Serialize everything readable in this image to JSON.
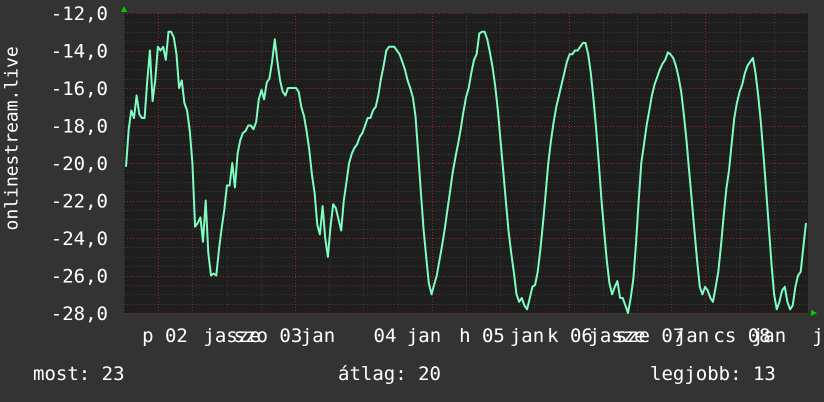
{
  "chart_data": {
    "type": "line",
    "ylabel": "onlinestream.live",
    "ylim": [
      -28,
      -12
    ],
    "yticks": [
      "-12,0",
      "-14,0",
      "-16,0",
      "-18,0",
      "-20,0",
      "-22,0",
      "-24,0",
      "-26,0",
      "-28,0"
    ],
    "xticks": [
      "p 02",
      "jasze",
      "szo 03",
      "jan",
      "04",
      "jan",
      "h 05",
      "jan",
      "k 06",
      "jasze",
      "sze 07",
      "jan",
      "cs 08",
      "jan",
      "j"
    ],
    "grid": true,
    "colors": {
      "line": "#7ffcc0",
      "background": "#333333",
      "plot": "#1e1e1e",
      "grid_minor": "#3c3c3c",
      "grid_major": "#8a2a2a"
    },
    "series": [
      {
        "values": [
          -20.2,
          -18.2,
          -17.2,
          -17.6,
          -16.4,
          -17.4,
          -17.6,
          -17.6,
          -15.6,
          -14.0,
          -16.7,
          -15.6,
          -13.8,
          -14.0,
          -13.8,
          -14.5,
          -13.0,
          -13.0,
          -13.3,
          -14.2,
          -16.0,
          -15.6,
          -16.8,
          -17.2,
          -18.3,
          -20.0,
          -23.4,
          -23.2,
          -22.9,
          -24.2,
          -22.0,
          -24.8,
          -26.0,
          -25.9,
          -26.0,
          -24.6,
          -23.5,
          -22.5,
          -21.2,
          -21.2,
          -20.0,
          -21.3,
          -19.5,
          -18.8,
          -18.4,
          -18.3,
          -18.0,
          -18.0,
          -18.2,
          -17.8,
          -16.6,
          -16.1,
          -16.6,
          -15.7,
          -15.5,
          -14.6,
          -13.4,
          -14.6,
          -15.6,
          -16.2,
          -16.4,
          -16.0,
          -16.0,
          -16.0,
          -16.0,
          -16.2,
          -17.0,
          -17.5,
          -18.3,
          -19.3,
          -20.6,
          -21.6,
          -23.3,
          -23.8,
          -22.3,
          -24.0,
          -25.0,
          -23.4,
          -22.2,
          -22.4,
          -23.0,
          -23.6,
          -22.0,
          -21.0,
          -20.0,
          -19.5,
          -19.2,
          -19.0,
          -18.6,
          -18.4,
          -18.0,
          -17.6,
          -17.6,
          -17.2,
          -17.0,
          -16.4,
          -15.5,
          -14.8,
          -14.0,
          -13.8,
          -13.8,
          -13.8,
          -14.0,
          -14.2,
          -14.6,
          -15.0,
          -15.6,
          -16.0,
          -16.5,
          -17.5,
          -19.5,
          -21.5,
          -23.5,
          -25.0,
          -26.4,
          -27.0,
          -26.5,
          -26.0,
          -25.2,
          -24.4,
          -23.5,
          -22.5,
          -21.5,
          -20.5,
          -19.7,
          -19.0,
          -18.2,
          -17.3,
          -16.5,
          -16.0,
          -15.2,
          -14.5,
          -14.2,
          -13.1,
          -13.0,
          -13.0,
          -13.4,
          -14.1,
          -14.9,
          -15.9,
          -17.2,
          -18.8,
          -20.4,
          -22.0,
          -23.6,
          -24.8,
          -25.8,
          -27.0,
          -27.4,
          -27.2,
          -27.6,
          -27.8,
          -27.2,
          -26.6,
          -26.5,
          -25.8,
          -24.6,
          -23.2,
          -21.6,
          -20.0,
          -18.8,
          -17.8,
          -17.0,
          -16.4,
          -15.8,
          -15.2,
          -14.6,
          -14.2,
          -14.2,
          -14.0,
          -14.0,
          -13.8,
          -13.6,
          -13.6,
          -14.2,
          -15.2,
          -16.6,
          -18.2,
          -20.0,
          -22.0,
          -23.6,
          -25.2,
          -26.4,
          -27.0,
          -26.6,
          -26.3,
          -27.2,
          -27.2,
          -27.6,
          -28.0,
          -27.2,
          -26.2,
          -24.3,
          -22.0,
          -20.0,
          -19.0,
          -18.0,
          -17.2,
          -16.4,
          -15.8,
          -15.4,
          -15.0,
          -14.7,
          -14.5,
          -14.1,
          -14.2,
          -14.4,
          -14.8,
          -15.4,
          -16.2,
          -17.4,
          -18.8,
          -20.4,
          -22.0,
          -23.6,
          -25.2,
          -26.6,
          -27.0,
          -26.6,
          -26.8,
          -27.2,
          -27.4,
          -26.6,
          -25.8,
          -24.4,
          -22.8,
          -21.4,
          -20.4,
          -19.0,
          -17.6,
          -16.8,
          -16.2,
          -15.8,
          -15.2,
          -14.8,
          -14.6,
          -14.4,
          -15.2,
          -16.4,
          -17.8,
          -19.6,
          -21.5,
          -23.4,
          -25.4,
          -27.0,
          -27.8,
          -27.4,
          -26.8,
          -26.6,
          -27.4,
          -27.8,
          -27.6,
          -26.6,
          -26.0,
          -25.8,
          -24.5,
          -23.2
        ]
      }
    ]
  },
  "footer": {
    "now": "most: 23",
    "avg": "átlag: 20",
    "best": "legjobb: 13"
  }
}
